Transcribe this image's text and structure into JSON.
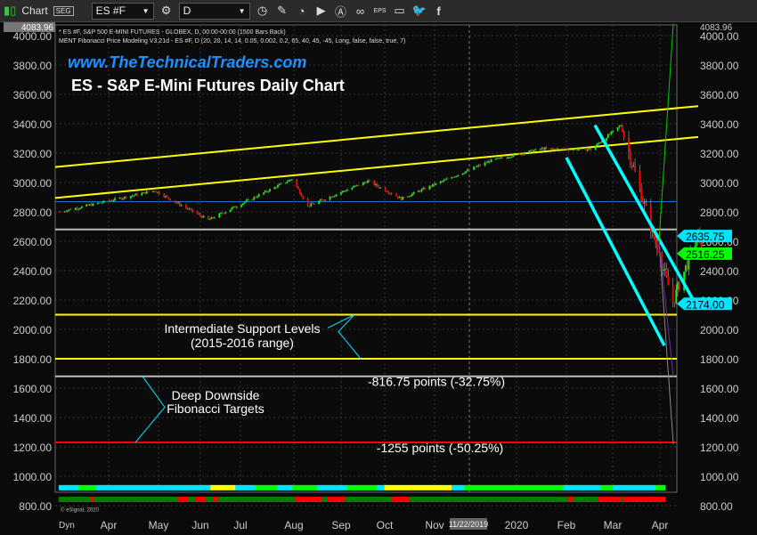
{
  "toolbar": {
    "app_label": "Chart",
    "symbol": "ES #F",
    "interval": "D",
    "icons": [
      "gear-icon",
      "clock-icon",
      "pencil-icon",
      "trend-icon",
      "play-icon",
      "alert-icon",
      "link-icon",
      "eps-icon",
      "comment-icon",
      "twitter-icon",
      "facebook-icon"
    ]
  },
  "header": {
    "line1": "* ES #F, S&P 500 E-MINI FUTURES - GLOBEX, D, 00:00-00:00 (1500 Bars Back)",
    "line2": "MENT Fibonacci Price Modeling V3.21d - ES #F, D (20, 20, 14, 14, 0.05, 0.002, 0.2, 65, 40, 45, -45, Long, false, false, true, 7)",
    "top_value": "4083.96"
  },
  "watermark": "www.TheTechnicalTraders.com",
  "chart_data": {
    "type": "candlestick",
    "title": "ES - S&P E-Mini Futures Daily Chart",
    "ylim": [
      800,
      4083.96
    ],
    "yticks": [
      "4000.00",
      "3800.00",
      "3600.00",
      "3400.00",
      "3200.00",
      "3000.00",
      "2800.00",
      "2600.00",
      "2400.00",
      "2200.00",
      "2000.00",
      "1800.00",
      "1600.00",
      "1400.00",
      "1200.00",
      "1000.00",
      "800.00"
    ],
    "xticks": [
      "Apr",
      "May",
      "Jun",
      "Jul",
      "Aug",
      "Sep",
      "Oct",
      "Nov",
      "2020",
      "Feb",
      "Mar",
      "Apr"
    ],
    "cursor_date": "11/22/2019",
    "price_path": [
      [
        "2019-03-01",
        2800
      ],
      [
        "2019-04-30",
        2945
      ],
      [
        "2019-06-03",
        2745
      ],
      [
        "2019-07-26",
        3025
      ],
      [
        "2019-08-05",
        2840
      ],
      [
        "2019-09-12",
        3010
      ],
      [
        "2019-10-03",
        2890
      ],
      [
        "2019-11-29",
        3150
      ],
      [
        "2019-12-31",
        3230
      ],
      [
        "2020-01-31",
        3225
      ],
      [
        "2020-02-19",
        3390
      ],
      [
        "2020-03-23",
        2190
      ],
      [
        "2020-04-08",
        2650
      ],
      [
        "2020-04-10",
        2516
      ]
    ],
    "price_labels": [
      {
        "value": "2635.75",
        "color": "#00e5ff"
      },
      {
        "value": "2516.25",
        "color": "#00ff00"
      },
      {
        "value": "2174.00",
        "color": "#00e5ff"
      }
    ],
    "levels": [
      {
        "price": 2680,
        "color": "#bbbbbb"
      },
      {
        "price": 2100,
        "color": "#ffff00"
      },
      {
        "price": 1800,
        "color": "#ffff00"
      },
      {
        "price": 1680,
        "color": "#bbbbbb"
      },
      {
        "price": 1230,
        "color": "#ff0000"
      }
    ],
    "annotations": {
      "support": "Intermediate Support Levels",
      "support_range": "(2015-2016 range)",
      "fib1": "Deep Downside",
      "fib2": "Fibonacci Targets",
      "target1": "-816.75 points (-32.75%)",
      "target2": "-1255 points (-50.25%)"
    },
    "copyright": "© eSignal, 2020",
    "dyn_label": "Dyn"
  },
  "colors": {
    "up": "#00ff00",
    "down": "#ff0000",
    "channel": "#ffff00",
    "down_channel": "#00ffff",
    "watermark": "#1e90ff"
  }
}
